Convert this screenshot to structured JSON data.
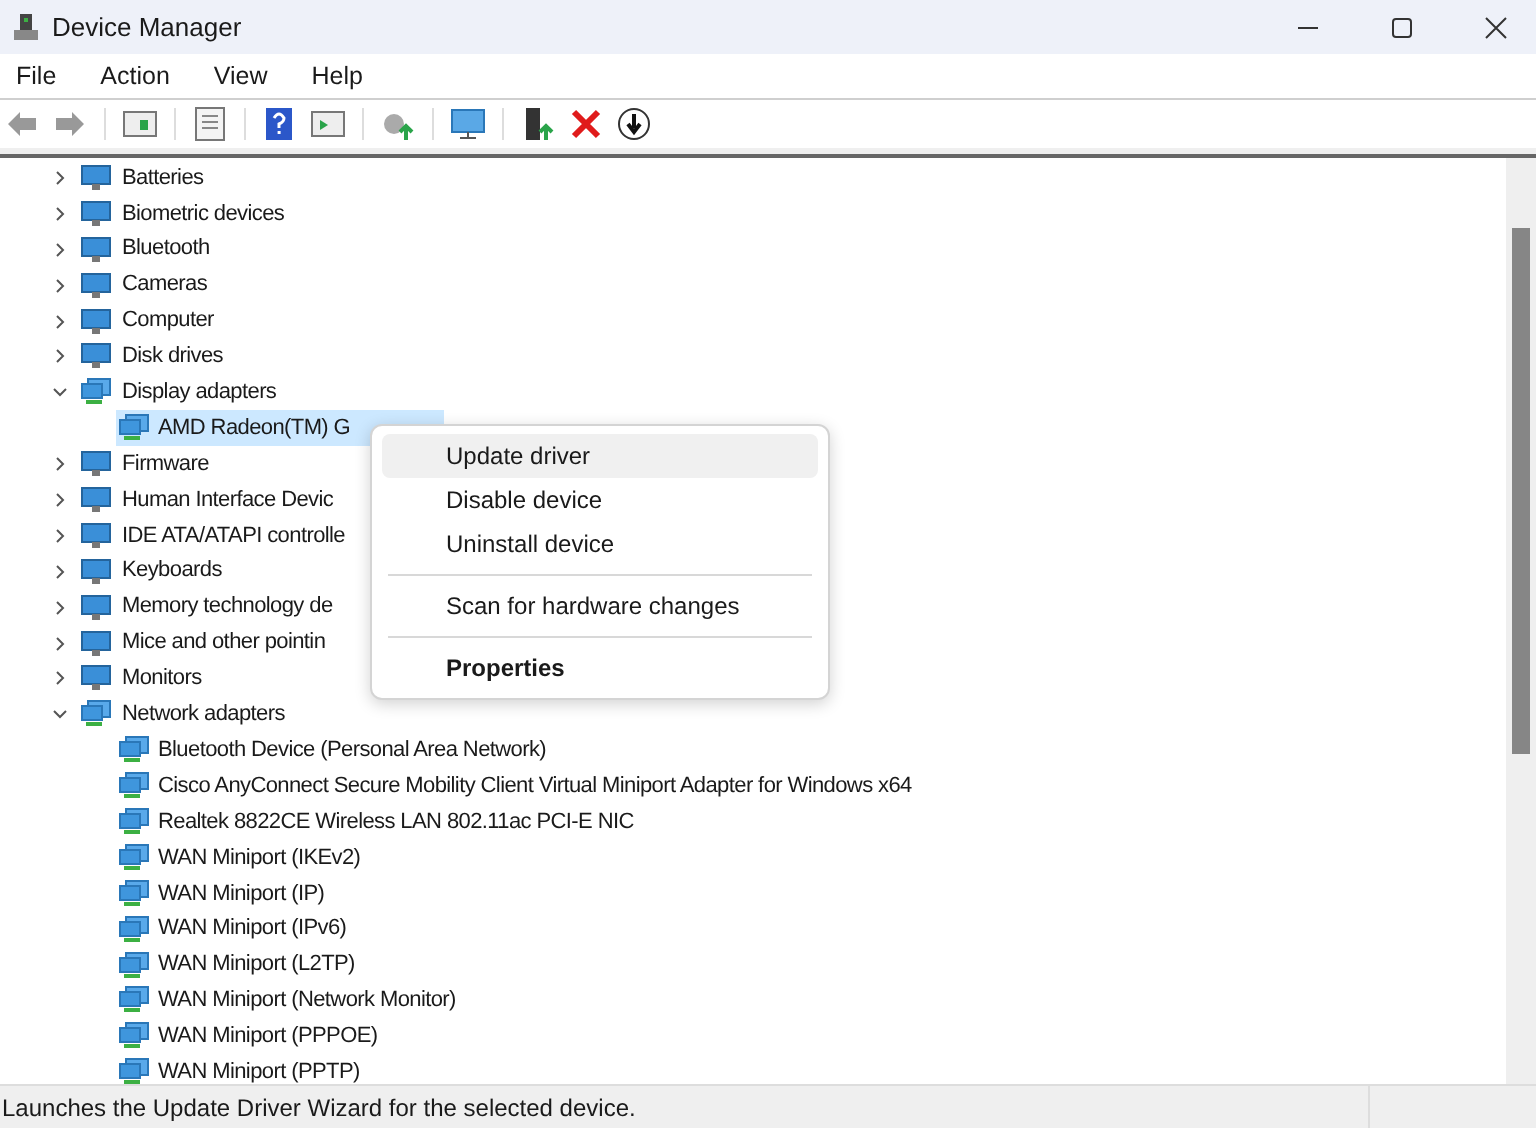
{
  "window": {
    "title": "Device Manager"
  },
  "menu": [
    "File",
    "Action",
    "View",
    "Help"
  ],
  "tree": [
    {
      "label": "Batteries",
      "expanded": false
    },
    {
      "label": "Biometric devices",
      "expanded": false
    },
    {
      "label": "Bluetooth",
      "expanded": false
    },
    {
      "label": "Cameras",
      "expanded": false
    },
    {
      "label": "Computer",
      "expanded": false
    },
    {
      "label": "Disk drives",
      "expanded": false
    },
    {
      "label": "Display adapters",
      "expanded": true,
      "children": [
        {
          "label": "AMD Radeon(TM) G",
          "selected": true
        }
      ]
    },
    {
      "label": "Firmware",
      "expanded": false
    },
    {
      "label": "Human Interface Devic",
      "expanded": false
    },
    {
      "label": "IDE ATA/ATAPI controlle",
      "expanded": false
    },
    {
      "label": "Keyboards",
      "expanded": false
    },
    {
      "label": "Memory technology de",
      "expanded": false
    },
    {
      "label": "Mice and other pointin",
      "expanded": false
    },
    {
      "label": "Monitors",
      "expanded": false
    },
    {
      "label": "Network adapters",
      "expanded": true,
      "children": [
        {
          "label": "Bluetooth Device (Personal Area Network)",
          "selected": false
        },
        {
          "label": "Cisco AnyConnect Secure Mobility Client Virtual Miniport Adapter for Windows x64",
          "selected": false
        },
        {
          "label": "Realtek 8822CE Wireless LAN 802.11ac PCI-E NIC",
          "selected": false
        },
        {
          "label": "WAN Miniport (IKEv2)",
          "selected": false
        },
        {
          "label": "WAN Miniport (IP)",
          "selected": false
        },
        {
          "label": "WAN Miniport (IPv6)",
          "selected": false
        },
        {
          "label": "WAN Miniport (L2TP)",
          "selected": false
        },
        {
          "label": "WAN Miniport (Network Monitor)",
          "selected": false
        },
        {
          "label": "WAN Miniport (PPPOE)",
          "selected": false
        },
        {
          "label": "WAN Miniport (PPTP)",
          "selected": false
        }
      ]
    }
  ],
  "context_menu": [
    {
      "label": "Update driver",
      "selected": true,
      "default": false,
      "separator_before": false
    },
    {
      "label": "Disable device",
      "selected": false,
      "default": false,
      "separator_before": false
    },
    {
      "label": "Uninstall device",
      "selected": false,
      "default": false,
      "separator_before": false
    },
    {
      "label": "Scan for hardware changes",
      "selected": false,
      "default": false,
      "separator_before": true
    },
    {
      "label": "Properties",
      "selected": false,
      "default": true,
      "separator_before": true
    }
  ],
  "status_bar": "Launches the Update Driver Wizard for the selected device."
}
